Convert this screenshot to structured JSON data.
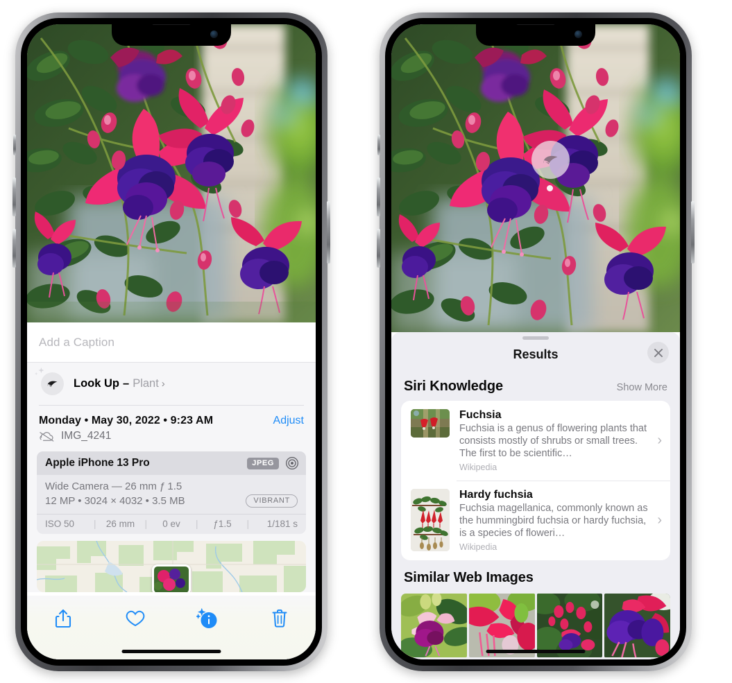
{
  "left_phone": {
    "caption_field": {
      "placeholder": "Add a Caption",
      "value": ""
    },
    "lookup": {
      "label": "Look Up",
      "dash": "–",
      "subject": "Plant",
      "chevron": "›",
      "icon": "leaf-icon"
    },
    "meta": {
      "date": "Monday • May 30, 2022 • 9:23 AM",
      "adjust_label": "Adjust",
      "filename": "IMG_4241",
      "cloud_icon": "cloud-slash-icon"
    },
    "camera_card": {
      "model": "Apple iPhone 13 Pro",
      "format_badge": "JPEG",
      "aperture_icon": "aperture-icon",
      "lens_line": "Wide Camera — 26 mm ƒ 1.5",
      "specs_line": "12 MP • 3024 × 4032 • 3.5 MB",
      "style_badge": "VIBRANT",
      "exif": [
        "ISO 50",
        "26 mm",
        "0 ev",
        "ƒ1.5",
        "1/181 s"
      ]
    },
    "toolbar": {
      "share_label": "share-icon",
      "favorite_label": "heart-icon",
      "info_label": "info-sparkle-icon",
      "delete_label": "trash-icon"
    }
  },
  "right_phone": {
    "badge": {
      "icon": "leaf-icon"
    },
    "sheet": {
      "title": "Results",
      "close_label": "✕"
    },
    "siri_knowledge": {
      "title": "Siri Knowledge",
      "action": "Show More",
      "items": [
        {
          "title": "Fuchsia",
          "description": "Fuchsia is a genus of flowering plants that consists mostly of shrubs or small trees. The first to be scientific…",
          "source": "Wikipedia",
          "chevron": "›"
        },
        {
          "title": "Hardy fuchsia",
          "description": "Fuchsia magellanica, commonly known as the hummingbird fuchsia or hardy fuchsia, is a species of floweri…",
          "source": "Wikipedia",
          "chevron": "›"
        }
      ]
    },
    "similar_web_images": {
      "title": "Similar Web Images",
      "count": 4
    }
  },
  "colors": {
    "accent_blue": "#1f8cf7",
    "sheet_bg": "#eeeef3",
    "card_bg": "#ffffff",
    "muted_text": "#79797f"
  }
}
